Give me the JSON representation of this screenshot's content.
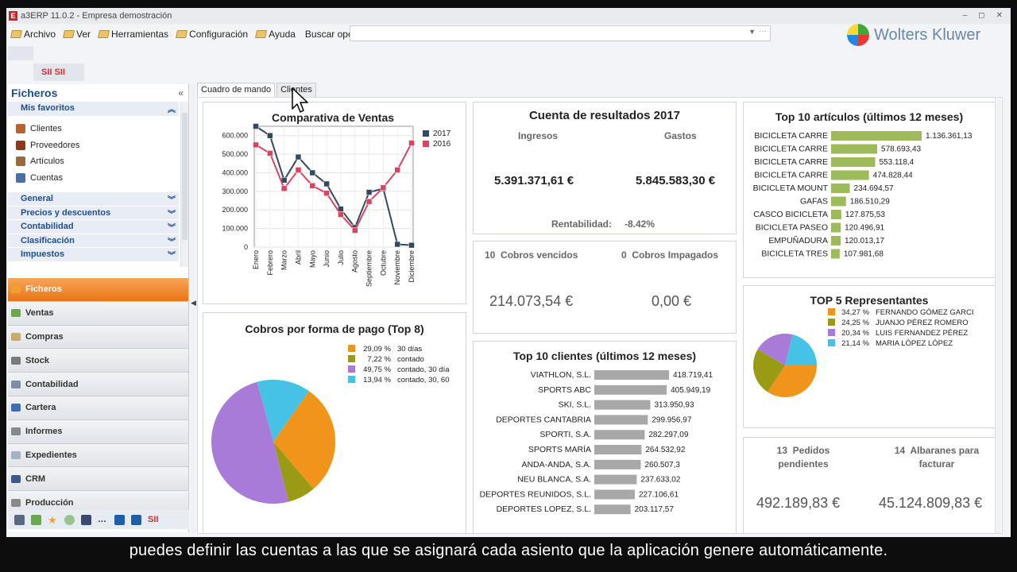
{
  "window": {
    "title": "a3ERP 11.0.2 - Empresa demostración",
    "controls": [
      "–",
      "◻",
      "✕"
    ]
  },
  "menu": {
    "items": [
      "Archivo",
      "Ver",
      "Herramientas",
      "Configuración",
      "Ayuda"
    ],
    "search_label": "Buscar opción:",
    "search_value": ""
  },
  "logo": {
    "text": "Wolters Kluwer"
  },
  "toolbar": {
    "sii_label": "SII SII"
  },
  "sidebar": {
    "title": "Ficheros",
    "favorites_label": "Mis favoritos",
    "favorites": [
      {
        "label": "Clientes",
        "icon": "clients-icon",
        "color": "#b5652f"
      },
      {
        "label": "Proveedores",
        "icon": "suppliers-icon",
        "color": "#8c3b1a"
      },
      {
        "label": "Artículos",
        "icon": "articles-icon",
        "color": "#9b6a3a"
      },
      {
        "label": "Cuentas",
        "icon": "accounts-icon",
        "color": "#4a6fa5"
      }
    ],
    "groups": [
      "General",
      "Precios y descuentos",
      "Contabilidad",
      "Clasificación",
      "Impuestos"
    ],
    "modules": [
      {
        "label": "Ficheros",
        "active": true,
        "color": "#f0a030"
      },
      {
        "label": "Ventas",
        "active": false,
        "color": "#6aa84f"
      },
      {
        "label": "Compras",
        "active": false,
        "color": "#c9a96e"
      },
      {
        "label": "Stock",
        "active": false,
        "color": "#7a7a7a"
      },
      {
        "label": "Contabilidad",
        "active": false,
        "color": "#7d8da6"
      },
      {
        "label": "Cartera",
        "active": false,
        "color": "#3d6db5"
      },
      {
        "label": "Informes",
        "active": false,
        "color": "#888"
      },
      {
        "label": "Expedientes",
        "active": false,
        "color": "#a6b1c2"
      },
      {
        "label": "CRM",
        "active": false,
        "color": "#3b5a8a"
      },
      {
        "label": "Producción",
        "active": false,
        "color": "#8a8a8a"
      }
    ],
    "bottom_icon_text": "SII"
  },
  "tabs": [
    "Cuadro de mando",
    "Clientes"
  ],
  "dashboard": {
    "sales_chart": {
      "title": "Comparativa de Ventas",
      "legend": [
        "2017",
        "2016"
      ],
      "colors": [
        "#34495e",
        "#d9445f"
      ]
    },
    "pay_chart": {
      "title": "Cobros por forma de pago (Top 8)",
      "legend": [
        {
          "pct": "29,09 %",
          "label": "30 días",
          "color": "#f0941a"
        },
        {
          "pct": "7,22 %",
          "label": "contado",
          "color": "#9a9a14"
        },
        {
          "pct": "49,75 %",
          "label": "contado, 30 día",
          "color": "#a97bd8"
        },
        {
          "pct": "13,94 %",
          "label": "contado, 30, 60",
          "color": "#46c2e6"
        }
      ]
    },
    "results": {
      "title": "Cuenta de resultados 2017",
      "ingresos_label": "Ingresos",
      "gastos_label": "Gastos",
      "ingresos": "5.391.371,61 €",
      "gastos": "5.845.583,30 €",
      "rentabilidad_label": "Rentabilidad:",
      "rentabilidad": "-8.42%"
    },
    "cobros": {
      "vencidos_count": "10",
      "vencidos_label": "Cobros vencidos",
      "impagados_count": "0",
      "impagados_label": "Cobros Impagados",
      "vencidos_amount": "214.073,54 €",
      "impagados_amount": "0,00 €"
    },
    "top_clients": {
      "title": "Top 10 clientes (últimos 12 meses)",
      "color": "#a8a8a8",
      "rows": [
        {
          "name": "VIATHLON, S.L.",
          "value": 418719.41,
          "label": "418.719,41"
        },
        {
          "name": "SPORTS ABC",
          "value": 405949.19,
          "label": "405.949,19"
        },
        {
          "name": "SKI, S.L.",
          "value": 313950.93,
          "label": "313.950,93"
        },
        {
          "name": "DEPORTES CANTABRIA",
          "value": 299956.97,
          "label": "299.956,97"
        },
        {
          "name": "SPORTI, S.A.",
          "value": 282297.09,
          "label": "282.297,09"
        },
        {
          "name": "SPORTS MARÍA",
          "value": 264532.92,
          "label": "264.532,92"
        },
        {
          "name": "ANDA-ANDA, S.A.",
          "value": 260507.3,
          "label": "260.507,3"
        },
        {
          "name": "NEU BLANCA, S.A.",
          "value": 237633.02,
          "label": "237.633,02"
        },
        {
          "name": "DEPORTES REUNIDOS, S.L.",
          "value": 227106.61,
          "label": "227.106,61"
        },
        {
          "name": "DEPORTES LOPEZ, S.L.",
          "value": 203117.57,
          "label": "203.117,57"
        }
      ]
    },
    "top_articles": {
      "title": "Top 10 artículos (últimos 12 meses)",
      "color": "#9dbb5a",
      "rows": [
        {
          "name": "BICICLETA CARRE",
          "value": 1136361.13,
          "label": "1.136.361,13"
        },
        {
          "name": "BICICLETA CARRE",
          "value": 578693.43,
          "label": "578.693,43"
        },
        {
          "name": "BICICLETA CARRE",
          "value": 553118.4,
          "label": "553.118,4"
        },
        {
          "name": "BICICLETA CARRE",
          "value": 474828.44,
          "label": "474.828,44"
        },
        {
          "name": "BICICLETA MOUNT",
          "value": 234694.57,
          "label": "234.694,57"
        },
        {
          "name": "GAFAS",
          "value": 186510.29,
          "label": "186.510,29"
        },
        {
          "name": "CASCO BICICLETA",
          "value": 127875.53,
          "label": "127.875,53"
        },
        {
          "name": "BICICLETA PASEO",
          "value": 120496.91,
          "label": "120.496,91"
        },
        {
          "name": "EMPUÑADURA",
          "value": 120013.17,
          "label": "120.013,17"
        },
        {
          "name": "BICICLETA TRES",
          "value": 107981.68,
          "label": "107.981,68"
        }
      ]
    },
    "top_reps": {
      "title": "TOP 5 Representantes",
      "legend": [
        {
          "pct": "34,27 %",
          "label": "FERNANDO GÓMEZ GARCI",
          "color": "#f0941a"
        },
        {
          "pct": "24,25 %",
          "label": "JUANJO PÉREZ ROMERO",
          "color": "#9a9a14"
        },
        {
          "pct": "20,34 %",
          "label": "LUIS FERNANDEZ PÉREZ",
          "color": "#a97bd8"
        },
        {
          "pct": "21,14 %",
          "label": "MARIA LÓPEZ LÓPEZ",
          "color": "#46c2e6"
        }
      ]
    },
    "orders": {
      "pedidos_count": "13",
      "pedidos_label": "Pedidos",
      "pedidos_label2": "pendientes",
      "albaranes_count": "14",
      "albaranes_label": "Albaranes para",
      "albaranes_label2": "facturar",
      "pedidos_amount": "492.189,83 €",
      "albaranes_amount": "45.124.809,83 €"
    }
  },
  "subtitle": "puedes definir las cuentas a las que se asignará cada asiento que la aplicación genere automáticamente.",
  "chart_data": [
    {
      "type": "line",
      "title": "Comparativa de Ventas",
      "x": [
        "Enero",
        "Febrero",
        "Marzo",
        "Abril",
        "Mayo",
        "Junio",
        "Julio",
        "Agosto",
        "Septiembre",
        "Octubre",
        "Noviembre",
        "Diciembre"
      ],
      "series": [
        {
          "name": "2017",
          "values": [
            650000,
            600000,
            360000,
            485000,
            400000,
            340000,
            205000,
            105000,
            295000,
            315000,
            15000,
            10000
          ]
        },
        {
          "name": "2016",
          "values": [
            550000,
            505000,
            315000,
            415000,
            330000,
            290000,
            175000,
            90000,
            245000,
            320000,
            415000,
            560000
          ]
        }
      ],
      "ylim": [
        0,
        650000
      ],
      "yticks": [
        "0",
        "100.000",
        "200.000",
        "300.000",
        "400.000",
        "500.000",
        "600.000"
      ],
      "grid": true,
      "legend": "top-right"
    },
    {
      "type": "pie",
      "title": "Cobros por forma de pago (Top 8)",
      "labels": [
        "30 días",
        "contado",
        "contado, 30 día",
        "contado, 30, 60"
      ],
      "values": [
        29.09,
        7.22,
        49.75,
        13.94
      ]
    },
    {
      "type": "pie",
      "title": "TOP 5 Representantes",
      "labels": [
        "FERNANDO GÓMEZ GARCI",
        "JUANJO PÉREZ ROMERO",
        "LUIS FERNANDEZ PÉREZ",
        "MARIA LÓPEZ LÓPEZ"
      ],
      "values": [
        34.27,
        24.25,
        20.34,
        21.14
      ]
    }
  ]
}
